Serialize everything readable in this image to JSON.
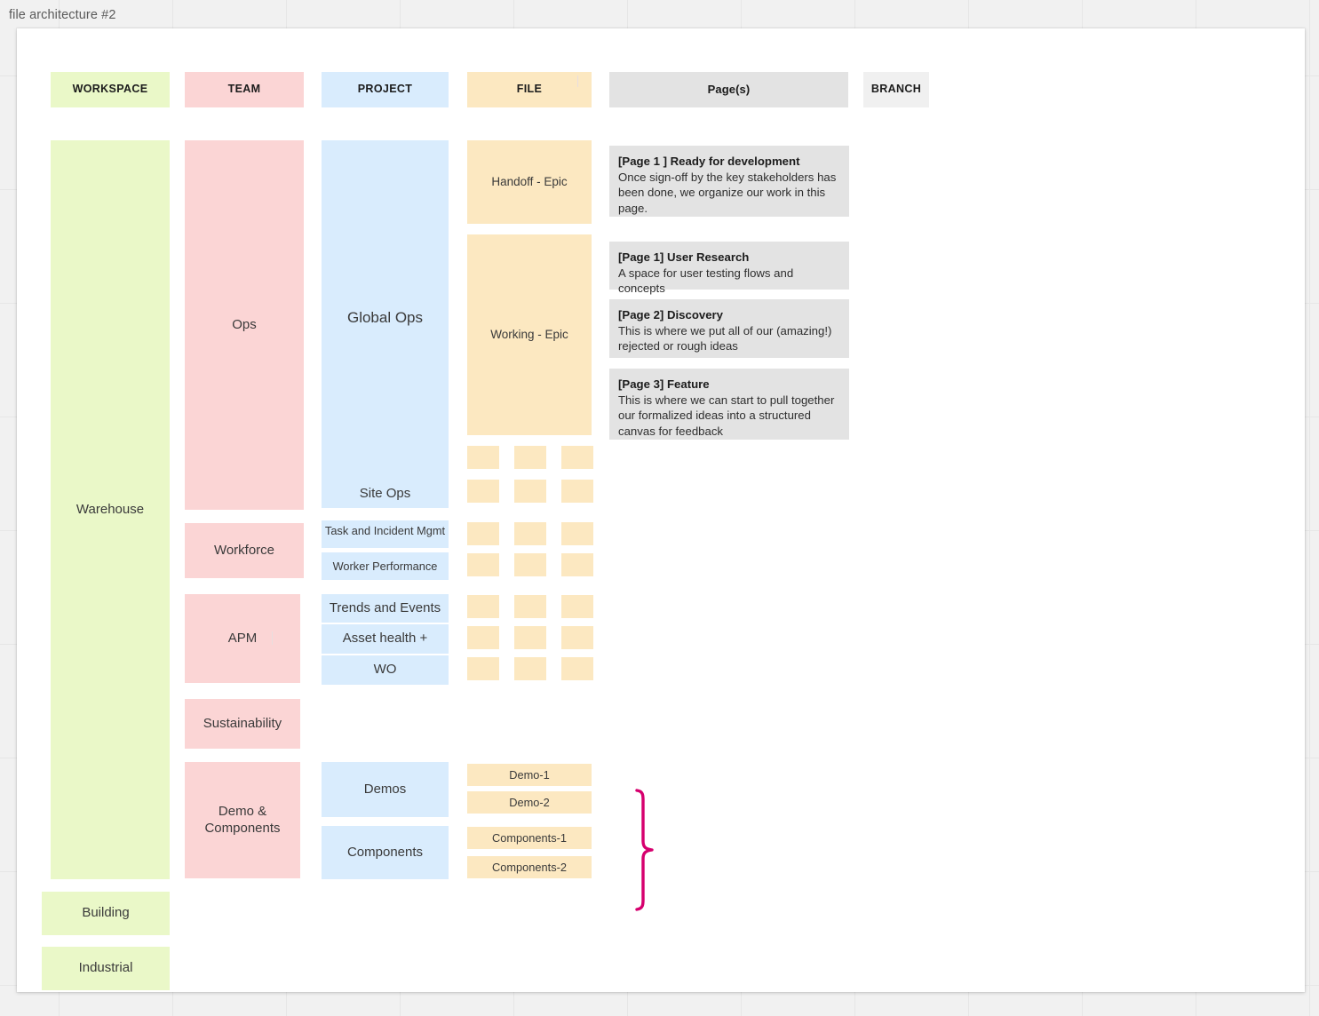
{
  "board": {
    "file_title": "file architecture #2"
  },
  "colors": {
    "workspace": "#eaf8c8",
    "team": "#fbd5d5",
    "project": "#d9ecfd",
    "file": "#fce8c1",
    "page": "#e3e3e3",
    "branch": "#f0f0f0",
    "brace": "#d6006e",
    "canvas": "#ffffff",
    "background": "#f1f1f1"
  },
  "headers": {
    "workspace": "WORKSPACE",
    "team": "TEAM",
    "project": "PROJECT",
    "file": "FILE",
    "pages": "Page(s)",
    "branch": "BRANCH"
  },
  "workspaces": [
    {
      "label": "Warehouse"
    },
    {
      "label": "Building"
    },
    {
      "label": "Industrial"
    }
  ],
  "teams": [
    {
      "label": "Ops"
    },
    {
      "label": "Workforce"
    },
    {
      "label": "APM"
    },
    {
      "label": "Sustainability"
    },
    {
      "label": "Demo & Components"
    }
  ],
  "projects": [
    {
      "label": "Global Ops"
    },
    {
      "label": "Site Ops"
    },
    {
      "label": "Task and Incident Mgmt"
    },
    {
      "label": "Worker Performance"
    },
    {
      "label": "Trends and Events"
    },
    {
      "label": "Asset health +"
    },
    {
      "label": "WO"
    },
    {
      "label": "Demos"
    },
    {
      "label": "Components"
    }
  ],
  "files": {
    "named": [
      {
        "label": "Handoff - Epic"
      },
      {
        "label": "Working - Epic"
      },
      {
        "label": "Demo-1"
      },
      {
        "label": "Demo-2"
      },
      {
        "label": "Components-1"
      },
      {
        "label": "Components-2"
      }
    ],
    "empty_grid": {
      "columns": 3,
      "rows": 7,
      "label": ""
    }
  },
  "pages": [
    {
      "title": "[Page 1 ] Ready for development",
      "description": "Once sign-off by the key stakeholders has been done, we organize our work in this page."
    },
    {
      "title": "[Page 1] User Research",
      "description": "A space for user testing flows and concepts"
    },
    {
      "title": "[Page 2] Discovery",
      "description": "This is where we put all of our (amazing!) rejected or rough ideas"
    },
    {
      "title": "[Page 3] Feature",
      "description": "This is where we can start to pull together our formalized ideas into a structured canvas for feedback"
    }
  ]
}
